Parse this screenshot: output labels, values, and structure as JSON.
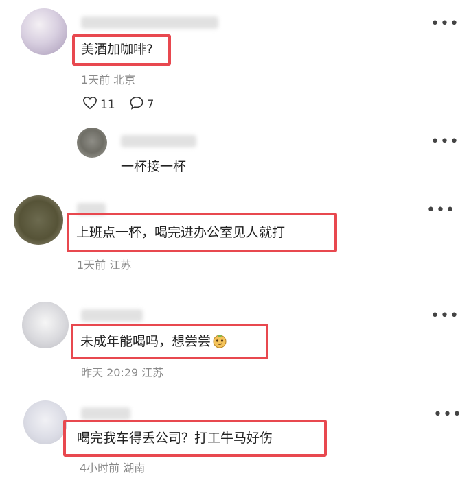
{
  "comments": [
    {
      "text": "美酒加咖啡?",
      "time": "1天前",
      "location": "北京",
      "likes": "11",
      "replies_count": "7",
      "reply": {
        "text": "一杯接一杯"
      }
    },
    {
      "text": "上班点一杯，喝完进办公室见人就打",
      "time": "1天前",
      "location": "江苏"
    },
    {
      "text": "未成年能喝吗，想尝尝",
      "time": "昨天 20:29",
      "location": "江苏",
      "emoji": "smiling-face-emoji"
    },
    {
      "text": "喝完我车得丢公司？打工牛马好伤",
      "time": "4小时前",
      "location": "湖南"
    }
  ],
  "icons": {
    "like": "heart-outline-icon",
    "reply": "speech-bubble-icon",
    "more": "more-dots-icon"
  },
  "colors": {
    "highlight": "#e8484f",
    "meta": "#8a8a8a"
  }
}
